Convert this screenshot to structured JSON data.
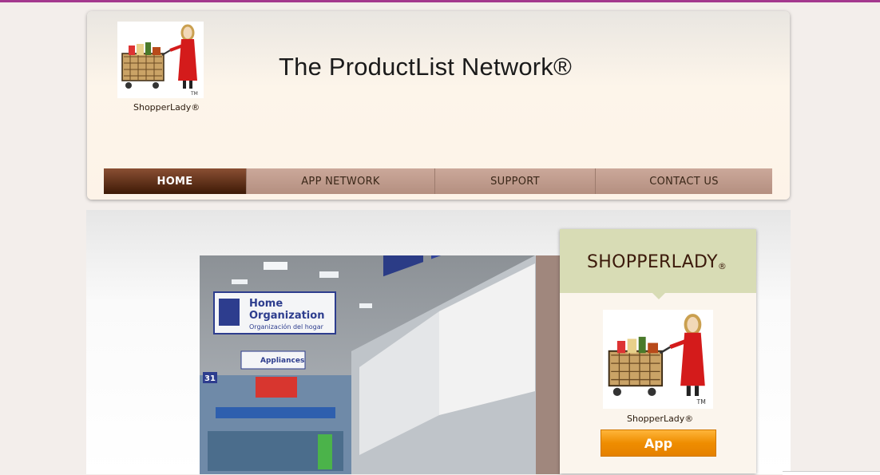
{
  "header": {
    "logo_caption": "ShopperLady®",
    "title": "The ProductList Network®"
  },
  "nav": {
    "items": [
      {
        "label": "HOME",
        "active": true
      },
      {
        "label": "APP NETWORK",
        "active": false
      },
      {
        "label": "SUPPORT",
        "active": false
      },
      {
        "label": "CONTACT US",
        "active": false
      }
    ]
  },
  "hero": {
    "signs": {
      "home_org_line1": "Home",
      "home_org_line2": "Organization",
      "home_org_spanish": "Organización del hogar",
      "appliances": "Appliances",
      "aisle_number": "31"
    }
  },
  "panel": {
    "title": "SHOPPERLADY",
    "title_mark": "®",
    "caption": "ShopperLady®",
    "button_label": "App"
  },
  "colors": {
    "accent_line": "#a4388e",
    "nav_active": "#3e1a06",
    "panel_head": "#d8dcb5",
    "app_button": "#ef8d00"
  }
}
